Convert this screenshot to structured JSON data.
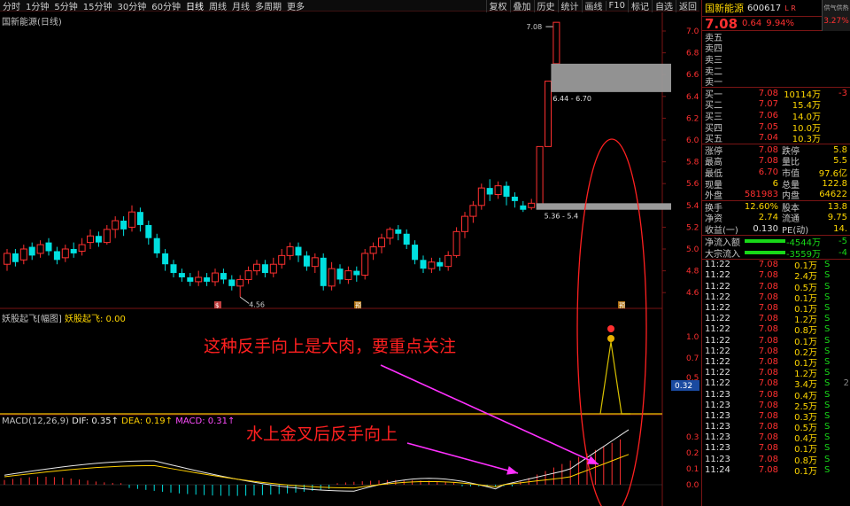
{
  "toolbar": {
    "left": [
      "分时",
      "1分钟",
      "5分钟",
      "15分钟",
      "30分钟",
      "60分钟",
      "日线",
      "周线",
      "月线",
      "多周期",
      "更多"
    ],
    "active": "日线",
    "right": [
      "复权",
      "叠加",
      "历史",
      "统计",
      "画线",
      "F10",
      "标记",
      "自选",
      "返回"
    ]
  },
  "chart": {
    "title": "国新能源(日线)",
    "y_ticks": [
      "7.00",
      "6.80",
      "6.60",
      "6.40",
      "6.20",
      "6.00",
      "5.80",
      "5.60",
      "5.40",
      "5.20",
      "5.00",
      "4.80",
      "4.60"
    ],
    "hi_label": "7.08",
    "low_label": "4.56",
    "gap_upper_label": "6.44 - 6.70",
    "gap_lower_label": "5.36 - 5.4",
    "markers": [
      "$",
      "预",
      "预"
    ]
  },
  "indicator": {
    "title": "妖股起飞[幅图]",
    "series_label": "妖股起飞: 0.00",
    "y_ticks": [
      "1.00",
      "0.75",
      "0.50"
    ],
    "current_tag": "0.32"
  },
  "macd": {
    "title": "MACD(12,26,9)",
    "dif": "DIF: 0.35↑",
    "dea": "DEA: 0.19↑",
    "macd": "MACD: 0.31↑",
    "y_ticks": [
      "0.30",
      "0.20",
      "0.10",
      "0.00"
    ]
  },
  "annotations": {
    "text1": "这种反手向上是大肉，要重点关注",
    "text2": "水上金叉后反手向上"
  },
  "colors": {
    "up": "#ff3030",
    "down": "#00e0e0",
    "annot": "#ff2020",
    "arrow": "#ff30ff",
    "dif": "#e8e8e8",
    "dea": "#ffd000"
  },
  "stock": {
    "name": "国新能源",
    "code": "600617",
    "badge": "L R",
    "mood_label": "供气供热",
    "mood_pct": "3.27%",
    "price": "7.08",
    "change": "0.64",
    "change_pct": "9.94%"
  },
  "asks": [
    {
      "name": "卖五",
      "price": "",
      "vol": "",
      "extra": ""
    },
    {
      "name": "卖四",
      "price": "",
      "vol": "",
      "extra": ""
    },
    {
      "name": "卖三",
      "price": "",
      "vol": "",
      "extra": ""
    },
    {
      "name": "卖二",
      "price": "",
      "vol": "",
      "extra": ""
    },
    {
      "name": "卖一",
      "price": "",
      "vol": "",
      "extra": ""
    }
  ],
  "bids": [
    {
      "name": "买一",
      "price": "7.08",
      "vol": "10114万",
      "extra": "-3"
    },
    {
      "name": "买二",
      "price": "7.07",
      "vol": "15.4万",
      "extra": ""
    },
    {
      "name": "买三",
      "price": "7.06",
      "vol": "14.0万",
      "extra": ""
    },
    {
      "name": "买四",
      "price": "7.05",
      "vol": "10.0万",
      "extra": ""
    },
    {
      "name": "买五",
      "price": "7.04",
      "vol": "10.3万",
      "extra": ""
    }
  ],
  "stats": [
    {
      "k1": "涨停",
      "v1": "7.08",
      "c1": "red",
      "k2": "跌停",
      "v2": "5.8",
      "c2": "grn"
    },
    {
      "k1": "最高",
      "v1": "7.08",
      "c1": "red",
      "k2": "量比",
      "v2": "5.5",
      "c2": "mag"
    },
    {
      "k1": "最低",
      "v1": "6.70",
      "c1": "red",
      "k2": "市值",
      "v2": "97.6亿",
      "c2": "yel"
    },
    {
      "k1": "现量",
      "v1": "6",
      "c1": "yel",
      "k2": "总量",
      "v2": "122.8",
      "c2": "yel"
    },
    {
      "k1": "外盘",
      "v1": "581983",
      "c1": "red",
      "k2": "内盘",
      "v2": "64622",
      "c2": "grn"
    }
  ],
  "stats2": [
    {
      "k1": "换手",
      "v1": "12.60%",
      "c1": "yel",
      "k2": "股本",
      "v2": "13.8",
      "c2": "yel"
    },
    {
      "k1": "净资",
      "v1": "2.74",
      "c1": "yel",
      "k2": "流通",
      "v2": "9.75",
      "c2": "yel"
    },
    {
      "k1": "收益(一)",
      "v1": "0.130",
      "c1": "wht",
      "k2": "PE(动)",
      "v2": "14.",
      "c2": "yel"
    }
  ],
  "flows": [
    {
      "k": "净流入额",
      "v": "-4544万",
      "e": "-5"
    },
    {
      "k": "大宗流入",
      "v": "-3559万",
      "e": "-4"
    }
  ],
  "ticks": [
    {
      "t": "11:22",
      "p": "7.08",
      "v": "0.1万",
      "d": "S",
      "x": ""
    },
    {
      "t": "11:22",
      "p": "7.08",
      "v": "2.4万",
      "d": "S",
      "x": ""
    },
    {
      "t": "11:22",
      "p": "7.08",
      "v": "0.5万",
      "d": "S",
      "x": ""
    },
    {
      "t": "11:22",
      "p": "7.08",
      "v": "0.1万",
      "d": "S",
      "x": ""
    },
    {
      "t": "11:22",
      "p": "7.08",
      "v": "0.1万",
      "d": "S",
      "x": ""
    },
    {
      "t": "11:22",
      "p": "7.08",
      "v": "1.2万",
      "d": "S",
      "x": ""
    },
    {
      "t": "11:22",
      "p": "7.08",
      "v": "0.8万",
      "d": "S",
      "x": ""
    },
    {
      "t": "11:22",
      "p": "7.08",
      "v": "0.1万",
      "d": "S",
      "x": ""
    },
    {
      "t": "11:22",
      "p": "7.08",
      "v": "0.2万",
      "d": "S",
      "x": ""
    },
    {
      "t": "11:22",
      "p": "7.08",
      "v": "0.1万",
      "d": "S",
      "x": ""
    },
    {
      "t": "11:22",
      "p": "7.08",
      "v": "1.2万",
      "d": "S",
      "x": ""
    },
    {
      "t": "11:22",
      "p": "7.08",
      "v": "3.4万",
      "d": "S",
      "x": "2"
    },
    {
      "t": "11:23",
      "p": "7.08",
      "v": "0.4万",
      "d": "S",
      "x": ""
    },
    {
      "t": "11:23",
      "p": "7.08",
      "v": "2.5万",
      "d": "S",
      "x": ""
    },
    {
      "t": "11:23",
      "p": "7.08",
      "v": "0.3万",
      "d": "S",
      "x": ""
    },
    {
      "t": "11:23",
      "p": "7.08",
      "v": "0.5万",
      "d": "S",
      "x": ""
    },
    {
      "t": "11:23",
      "p": "7.08",
      "v": "0.4万",
      "d": "S",
      "x": ""
    },
    {
      "t": "11:23",
      "p": "7.08",
      "v": "0.1万",
      "d": "S",
      "x": ""
    },
    {
      "t": "11:23",
      "p": "7.08",
      "v": "0.8万",
      "d": "S",
      "x": ""
    },
    {
      "t": "11:24",
      "p": "7.08",
      "v": "0.1万",
      "d": "S",
      "x": ""
    }
  ]
}
